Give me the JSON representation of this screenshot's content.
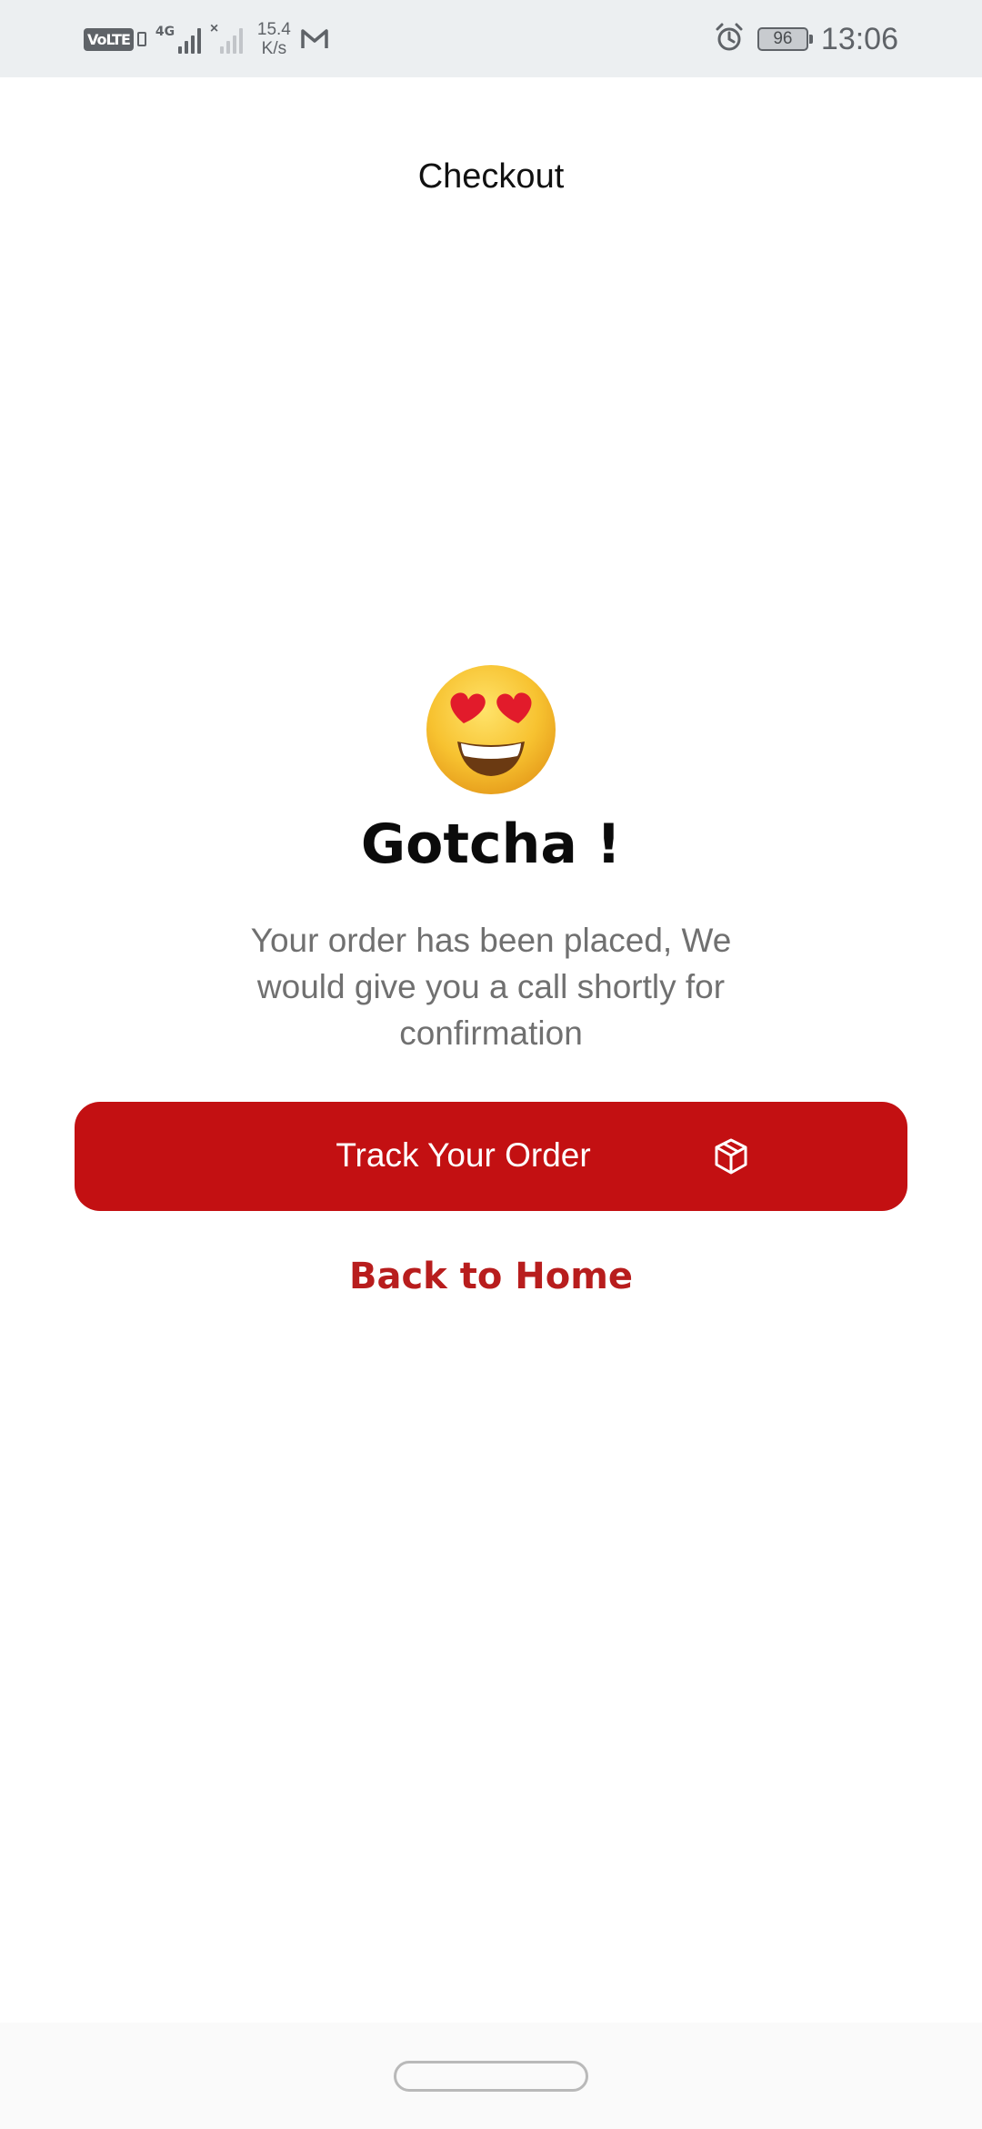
{
  "status_bar": {
    "volte_label": "VoLTE",
    "network_type": "4G",
    "speed_value": "15.4",
    "speed_unit": "K/s",
    "battery_level": "96",
    "time": "13:06",
    "icons": [
      "volte-icon",
      "signal-icon",
      "no-signal-icon",
      "gmail-icon",
      "alarm-icon",
      "battery-icon"
    ]
  },
  "header": {
    "title": "Checkout"
  },
  "confirmation": {
    "emoji": "heart-eyes-emoji",
    "headline": "Gotcha !",
    "message": "Your order has been placed, We would give you a call shortly for confirmation"
  },
  "actions": {
    "track_label": "Track Your Order",
    "track_icon": "package-icon",
    "back_label": "Back to Home"
  },
  "colors": {
    "accent": "#c31012",
    "link": "#b81d1d",
    "status_bar_bg": "#eceff1"
  }
}
